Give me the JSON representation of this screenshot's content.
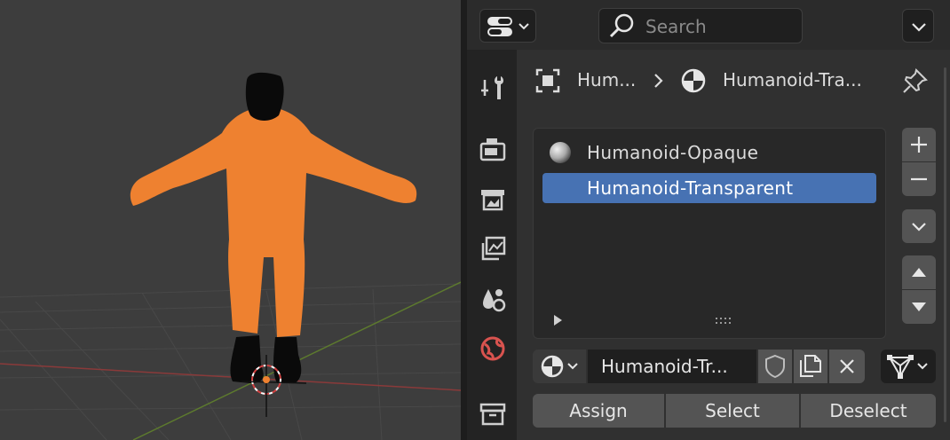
{
  "header": {
    "search_placeholder": "Search"
  },
  "tabs": [
    {
      "name": "tool"
    },
    {
      "name": "render"
    },
    {
      "name": "output"
    },
    {
      "name": "view-layer"
    },
    {
      "name": "scene"
    },
    {
      "name": "world"
    },
    {
      "name": "collection"
    }
  ],
  "breadcrumb": {
    "object": "Hum...",
    "material": "Humanoid-Tra..."
  },
  "material_slots": [
    {
      "label": "Humanoid-Opaque",
      "selected": false
    },
    {
      "label": "Humanoid-Transparent",
      "selected": true
    }
  ],
  "material_selector": {
    "name": "Humanoid-Tr..."
  },
  "actions": {
    "assign": "Assign",
    "select": "Select",
    "deselect": "Deselect"
  },
  "icons": {
    "editor_type": "properties-editor-icon",
    "search": "search-icon",
    "pin": "pin-icon",
    "add": "plus-icon",
    "remove": "minus-icon",
    "specials": "chevron-down-icon",
    "move_up": "triangle-up-icon",
    "move_down": "triangle-down-icon",
    "fake_user": "shield-icon",
    "duplicate": "duplicate-icon",
    "unlink": "close-icon",
    "mode": "vertex-mode-icon"
  },
  "colors": {
    "selection": "#4772b3",
    "figure_body": "#ee8130",
    "world_tab": "#d9534f"
  }
}
